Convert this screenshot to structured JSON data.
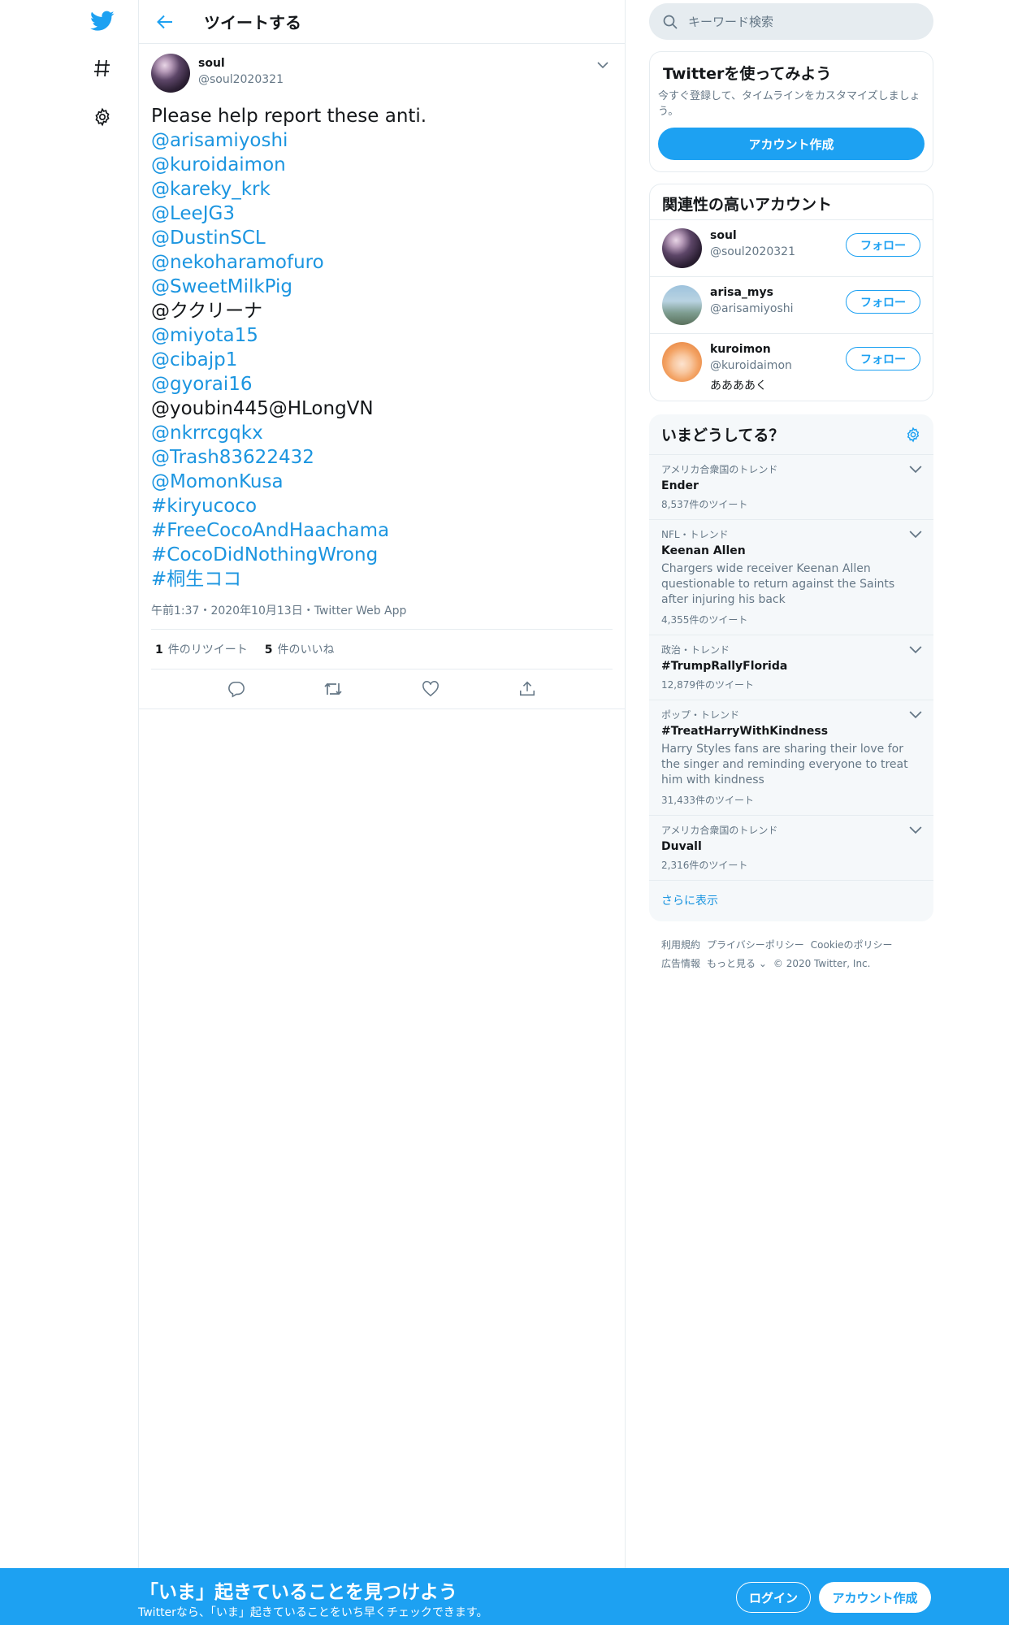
{
  "nav": {
    "icons": [
      "twitter-logo",
      "hashtag-icon",
      "gear-icon"
    ]
  },
  "header": {
    "title": "ツイートする"
  },
  "tweet": {
    "author_name": "soul",
    "author_handle": "@soul2020321",
    "lines": [
      {
        "text": "Please help report these anti.",
        "link": false
      },
      {
        "text": "@arisamiyoshi",
        "link": true
      },
      {
        "text": "@kuroidaimon",
        "link": true
      },
      {
        "text": "@kareky_krk",
        "link": true
      },
      {
        "text": "@LeeJG3",
        "link": true
      },
      {
        "text": "@DustinSCL",
        "link": true
      },
      {
        "text": "@nekoharamofuro",
        "link": true
      },
      {
        "text": "@SweetMilkPig",
        "link": true
      },
      {
        "text": "@ククリーナ",
        "link": false
      },
      {
        "text": "@miyota15",
        "link": true
      },
      {
        "text": "@cibajp1",
        "link": true
      },
      {
        "text": "@gyorai16",
        "link": true
      },
      {
        "text": "@youbin445@HLongVN",
        "link": false
      },
      {
        "text": "@nkrrcgqkx",
        "link": true
      },
      {
        "text": "@Trash83622432",
        "link": true
      },
      {
        "text": "@MomonKusa",
        "link": true
      },
      {
        "text": "#kiryucoco",
        "link": true
      },
      {
        "text": "#FreeCocoAndHaachama",
        "link": true
      },
      {
        "text": "#CocoDidNothingWrong",
        "link": true
      },
      {
        "text": "#桐生ココ",
        "link": true
      }
    ],
    "meta": "午前1:37・2020年10月13日・Twitter Web App",
    "retweet_count": "1",
    "retweet_label": "件のリツイート",
    "like_count": "5",
    "like_label": "件のいいね"
  },
  "search": {
    "placeholder": "キーワード検索"
  },
  "signup_card": {
    "title": "Twitterを使ってみよう",
    "description": "今すぐ登録して、タイムラインをカスタマイズしましょう。",
    "button": "アカウント作成"
  },
  "related": {
    "title": "関連性の高いアカウント",
    "follow_label": "フォロー",
    "accounts": [
      {
        "name": "soul",
        "handle": "@soul2020321",
        "bio": ""
      },
      {
        "name": "arisa_mys",
        "handle": "@arisamiyoshi",
        "bio": ""
      },
      {
        "name": "kuroimon",
        "handle": "@kuroidaimon",
        "bio": "ああああく"
      }
    ]
  },
  "trends": {
    "title": "いまどうしてる？",
    "items": [
      {
        "meta": "アメリカ合衆国のトレンド",
        "name": "Ender",
        "desc": "",
        "count": "8,537件のツイート"
      },
      {
        "meta": "NFL・トレンド",
        "name": "Keenan Allen",
        "desc": "Chargers wide receiver Keenan Allen questionable to return against the Saints after injuring his back",
        "count": "4,355件のツイート"
      },
      {
        "meta": "政治・トレンド",
        "name": "#TrumpRallyFlorida",
        "desc": "",
        "count": "12,879件のツイート"
      },
      {
        "meta": "ポップ・トレンド",
        "name": "#TreatHarryWithKindness",
        "desc": "Harry Styles fans are sharing their love for the singer and reminding everyone to treat him with kindness",
        "count": "31,433件のツイート"
      },
      {
        "meta": "アメリカ合衆国のトレンド",
        "name": "Duvall",
        "desc": "",
        "count": "2,316件のツイート"
      }
    ],
    "more": "さらに表示"
  },
  "footer": {
    "links": [
      "利用規約",
      "プライバシーポリシー",
      "Cookieのポリシー",
      "広告情報",
      "もっと見る ⌄",
      "© 2020 Twitter, Inc."
    ]
  },
  "bottom_bar": {
    "title": "「いま」起きていることを見つけよう",
    "subtitle": "Twitterなら、「いま」起きていることをいち早くチェックできます。",
    "login": "ログイン",
    "signup": "アカウント作成"
  },
  "colors": {
    "brand": "#1da1f2",
    "link": "#1b95e0",
    "secondary_text": "#657786",
    "border": "#e6ecf0"
  }
}
